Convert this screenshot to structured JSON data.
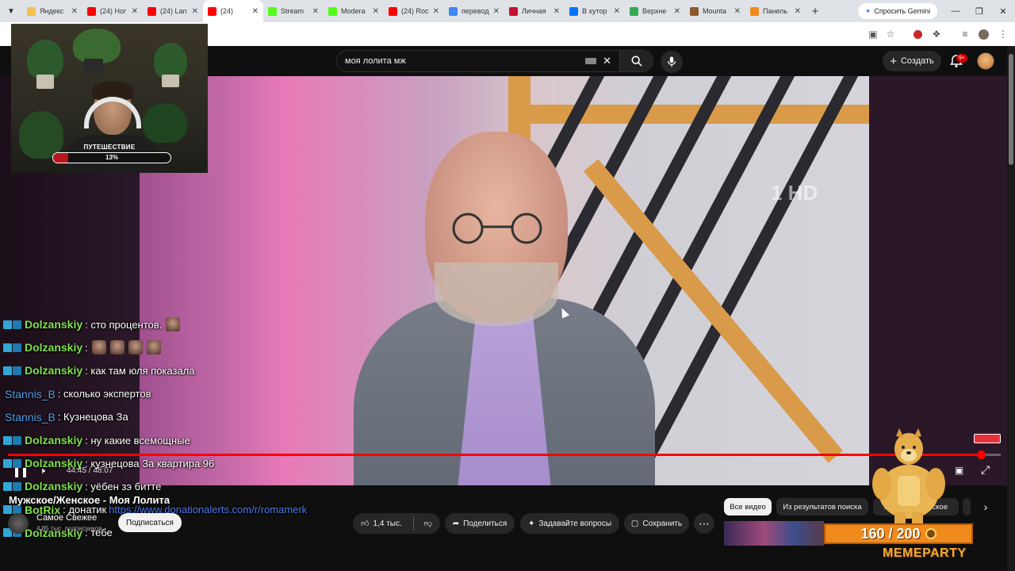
{
  "browser": {
    "tabs": [
      {
        "title": "Яндекс",
        "color": "#f2c14e"
      },
      {
        "title": "(24) Hor",
        "color": "#ff0000"
      },
      {
        "title": "(24) Lan",
        "color": "#ff0000"
      },
      {
        "title": "(24)",
        "color": "#ff0000",
        "active": true
      },
      {
        "title": "Stream",
        "color": "#53fc18"
      },
      {
        "title": "Modera",
        "color": "#53fc18"
      },
      {
        "title": "(24) Roc",
        "color": "#ff0000"
      },
      {
        "title": "перевод",
        "color": "#4285f4"
      },
      {
        "title": "Личная",
        "color": "#c8102e"
      },
      {
        "title": "В хутор",
        "color": "#0077ff"
      },
      {
        "title": "Верхне",
        "color": "#34a853"
      },
      {
        "title": "Mounta",
        "color": "#8b5a2b"
      },
      {
        "title": "Панель",
        "color": "#f08a1c"
      }
    ],
    "gemini_label": "Спросить Gemini"
  },
  "youtube": {
    "search_value": "моя лолита мж",
    "create_label": "Создать",
    "notifications_badge": "9+",
    "channel_logo": "1 HD"
  },
  "webcam": {
    "label": "ПУТЕШЕСТВИЕ",
    "progress_text": "13%",
    "progress": 0.13
  },
  "chat": [
    {
      "user": "Dolzanskiy",
      "kind": "green",
      "msg": ": сто процентов.",
      "emotes": 1
    },
    {
      "user": "Dolzanskiy",
      "kind": "green",
      "msg": ":",
      "emotes": 4
    },
    {
      "user": "Dolzanskiy",
      "kind": "green",
      "msg": ": как там юля показала",
      "emotes": 0
    },
    {
      "user": "Stannis_B",
      "kind": "blue",
      "msg": ": сколько экспертов",
      "emotes": 0
    },
    {
      "user": "Stannis_B",
      "kind": "blue",
      "msg": ": Кузнецова За",
      "emotes": 0
    },
    {
      "user": "Dolzanskiy",
      "kind": "green",
      "msg": ": ну какие всемощные",
      "emotes": 0
    },
    {
      "user": "Dolzanskiy",
      "kind": "green",
      "msg": ": кузнецова За квартира 96",
      "emotes": 0
    },
    {
      "user": "Dolzanskiy",
      "kind": "green",
      "msg": ": уёбен зэ битте",
      "emotes": 0
    },
    {
      "user": "BotRix",
      "kind": "green",
      "msg": ": донатик",
      "link": "https://www.donationalerts.com/r/romamerk",
      "emotes": 0
    },
    {
      "user": "Dolzanskiy",
      "kind": "green",
      "msg": ": тебе",
      "emotes": 0
    }
  ],
  "player": {
    "timecode": "44:45 / 48:07",
    "progress": 0.98
  },
  "video": {
    "title": "Мужское/Женское - Моя Лолита",
    "channel": "Самое Свежее",
    "subscribers": "4,85 тыс. подписчиков",
    "subscribe_label": "Подписаться",
    "likes": "1,4 тыс.",
    "share_label": "Поделиться",
    "ask_label": "Задавайте вопросы",
    "save_label": "Сохранить"
  },
  "chips": {
    "all": "Все видео",
    "search_results": "Из результатов поиска",
    "related": "Мужское/Женское"
  },
  "memeparty": {
    "counter": "160 / 200",
    "title": "MEMEPARTY",
    "current": 160,
    "max": 200
  }
}
